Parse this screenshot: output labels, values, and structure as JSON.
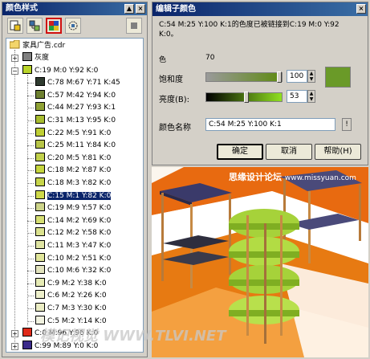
{
  "docker": {
    "title": "颜色样式",
    "file_name": "家具广告.cdr",
    "nodes": [
      {
        "label": "灰度",
        "color": "#808080",
        "level": 1,
        "expander": "+"
      },
      {
        "label": "C:19 M:0 Y:92 K:0",
        "color": "#b9d42a",
        "level": 1,
        "expander": "-"
      },
      {
        "label": "C:78 M:67 Y:71 K:45",
        "color": "#2e3a2e",
        "level": 2
      },
      {
        "label": "C:57 M:42 Y:94 K:0",
        "color": "#6e8030",
        "level": 2
      },
      {
        "label": "C:44 M:27 Y:93 K:1",
        "color": "#90a235",
        "level": 2
      },
      {
        "label": "C:31 M:13 Y:95 K:0",
        "color": "#a8bd30",
        "level": 2
      },
      {
        "label": "C:22 M:5 Y:91 K:0",
        "color": "#bfcf34",
        "level": 2
      },
      {
        "label": "C:25 M:11 Y:84 K:0",
        "color": "#b8c548",
        "level": 2
      },
      {
        "label": "C:20 M:5 Y:81 K:0",
        "color": "#c2d14c",
        "level": 2
      },
      {
        "label": "C:18 M:2 Y:87 K:0",
        "color": "#c6d63e",
        "level": 2
      },
      {
        "label": "C:18 M:3 Y:82 K:0",
        "color": "#c7d54a",
        "level": 2
      },
      {
        "label": "C:15 M:1 Y:82 K:0",
        "color": "#cfd94a",
        "level": 2,
        "selected": true
      },
      {
        "label": "C:19 M:9 Y:57 K:0",
        "color": "#cdd48a",
        "level": 2
      },
      {
        "label": "C:14 M:2 Y:69 K:0",
        "color": "#d6df73",
        "level": 2
      },
      {
        "label": "C:12 M:2 Y:58 K:0",
        "color": "#dbe28e",
        "level": 2
      },
      {
        "label": "C:11 M:3 Y:47 K:0",
        "color": "#dfe4a3",
        "level": 2
      },
      {
        "label": "C:10 M:2 Y:51 K:0",
        "color": "#e1e69b",
        "level": 2
      },
      {
        "label": "C:10 M:6 Y:32 K:0",
        "color": "#e3e4be",
        "level": 2
      },
      {
        "label": "C:9 M:2 Y:38 K:0",
        "color": "#e6ebb5",
        "level": 2
      },
      {
        "label": "C:6 M:2 Y:26 K:0",
        "color": "#eef0cc",
        "level": 2
      },
      {
        "label": "C:7 M:3 Y:30 K:0",
        "color": "#ebedc4",
        "level": 2
      },
      {
        "label": "C:5 M:2 Y:14 K:0",
        "color": "#f1f2e0",
        "level": 2
      },
      {
        "label": "C:0 M:96 Y:96 K:0",
        "color": "#e02a1a",
        "level": 1,
        "expander": "+"
      },
      {
        "label": "C:99 M:89 Y:0 K:0",
        "color": "#3a2a8a",
        "level": 1,
        "expander": "+"
      }
    ]
  },
  "dialog": {
    "title": "编辑子颜色",
    "info_line1": "C:54 M:25 Y:100 K:1的色度已被链接到C:19 M:0 Y:92",
    "info_line2": "K:0。",
    "hue_label": "色",
    "hue_value": "70",
    "saturation_label": "饱和度",
    "saturation_value": "100",
    "saturation_level": 100,
    "brightness_label": "亮度(B):",
    "brightness_value": "53",
    "brightness_level": 53,
    "preview_color": "#6a9a28",
    "color_name_label": "颜色名称",
    "color_name_value": "C:54 M:25 Y:100 K:1",
    "ok_label": "确定",
    "cancel_label": "取消",
    "help_label": "帮助(H)"
  },
  "watermarks": {
    "top": "思缘设计论坛",
    "top_url": "www.missyuan.com",
    "bottom": "模记视觉 WWW.TLVI.NET"
  }
}
